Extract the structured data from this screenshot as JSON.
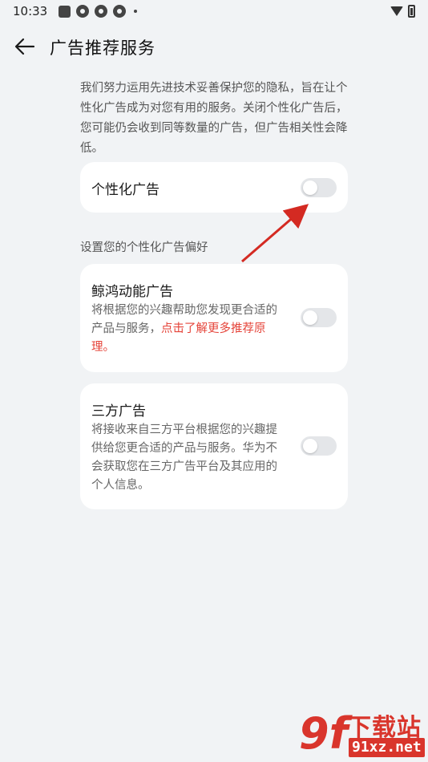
{
  "status_bar": {
    "time": "10:33",
    "icons": [
      "square-icon",
      "ring-icon",
      "ring-icon",
      "ring-icon",
      "dot-icon",
      "wifi-icon",
      "battery-icon"
    ]
  },
  "header": {
    "title": "广告推荐服务",
    "back_icon": "arrow-left-icon"
  },
  "intro": "我们努力运用先进技术妥善保护您的隐私，旨在让个性化广告成为对您有用的服务。关闭个性化广告后，您可能仍会收到同等数量的广告，但广告相关性会降低。",
  "personalized_ads": {
    "label": "个性化广告",
    "enabled": false
  },
  "preferences_section": {
    "label": "设置您的个性化广告偏好"
  },
  "petal_ads": {
    "title": "鲸鸿动能广告",
    "desc": "将根据您的兴趣帮助您发现更合适的产品与服务，",
    "link": "点击了解更多推荐原理。",
    "enabled": false
  },
  "third_party_ads": {
    "title": "三方广告",
    "desc": "将接收来自三方平台根据您的兴趣提供给您更合适的产品与服务。华为不会获取您在三方广告平台及其应用的个人信息。",
    "enabled": false
  },
  "watermark": {
    "logo": "9f",
    "top": "下载站",
    "bottom": "91xz.net"
  },
  "colors": {
    "background": "#f1f3f5",
    "card": "#ffffff",
    "link": "#e5443a",
    "toggle_off": "#e4e6e9",
    "annotation_arrow": "#d42a22"
  }
}
